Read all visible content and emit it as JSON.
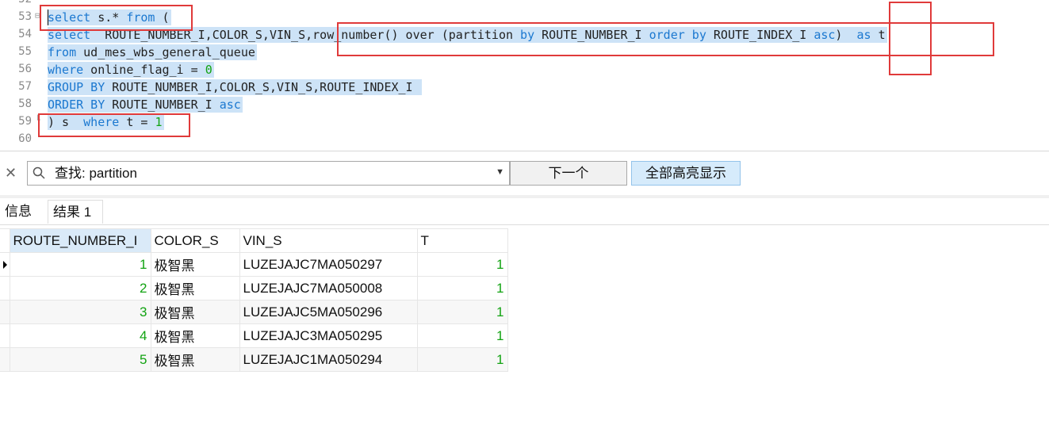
{
  "editor": {
    "lines": [
      {
        "num": "52",
        "tokens": []
      },
      {
        "num": "53",
        "tokens": [
          {
            "t": "select",
            "k": "kw"
          },
          {
            "t": " s.* "
          },
          {
            "t": "from",
            "k": "kw"
          },
          {
            "t": " ("
          }
        ]
      },
      {
        "num": "54",
        "tokens": [
          {
            "t": "select",
            "k": "kw"
          },
          {
            "t": "  ROUTE_NUMBER_I,COLOR_S,VIN_S,row_number() over (partition "
          },
          {
            "t": "by",
            "k": "kw"
          },
          {
            "t": " ROUTE_NUMBER_I "
          },
          {
            "t": "order by",
            "k": "kw"
          },
          {
            "t": " ROUTE_INDEX_I "
          },
          {
            "t": "asc",
            "k": "kw"
          },
          {
            "t": ")  "
          },
          {
            "t": "as",
            "k": "kw"
          },
          {
            "t": " t"
          }
        ]
      },
      {
        "num": "55",
        "tokens": [
          {
            "t": "from",
            "k": "kw"
          },
          {
            "t": " ud_mes_wbs_general_queue"
          }
        ]
      },
      {
        "num": "56",
        "tokens": [
          {
            "t": "where",
            "k": "kw"
          },
          {
            "t": " online_flag_i = "
          },
          {
            "t": "0",
            "k": "num"
          }
        ]
      },
      {
        "num": "57",
        "tokens": [
          {
            "t": "GROUP BY",
            "k": "kw"
          },
          {
            "t": " ROUTE_NUMBER_I,COLOR_S,VIN_S,ROUTE_INDEX_I "
          }
        ]
      },
      {
        "num": "58",
        "tokens": [
          {
            "t": "ORDER BY",
            "k": "kw"
          },
          {
            "t": " ROUTE_NUMBER_I "
          },
          {
            "t": "asc",
            "k": "kw"
          }
        ]
      },
      {
        "num": "59",
        "tokens": [
          {
            "t": ") s  "
          },
          {
            "t": "where",
            "k": "kw"
          },
          {
            "t": " t = "
          },
          {
            "t": "1",
            "k": "num"
          }
        ]
      },
      {
        "num": "60",
        "tokens": []
      }
    ]
  },
  "find": {
    "value": "查找: partition",
    "next_label": "下一个",
    "highlight_all_label": "全部高亮显示"
  },
  "tabs": {
    "info": "信息",
    "result": "结果 1"
  },
  "table": {
    "columns": [
      "ROUTE_NUMBER_I",
      "COLOR_S",
      "VIN_S",
      "T"
    ],
    "rows": [
      [
        "1",
        "极智黑",
        "LUZEJAJC7MA050297",
        "1"
      ],
      [
        "2",
        "极智黑",
        "LUZEJAJC7MA050008",
        "1"
      ],
      [
        "3",
        "极智黑",
        "LUZEJAJC5MA050296",
        "1"
      ],
      [
        "4",
        "极智黑",
        "LUZEJAJC3MA050295",
        "1"
      ],
      [
        "5",
        "极智黑",
        "LUZEJAJC1MA050294",
        "1"
      ]
    ]
  }
}
